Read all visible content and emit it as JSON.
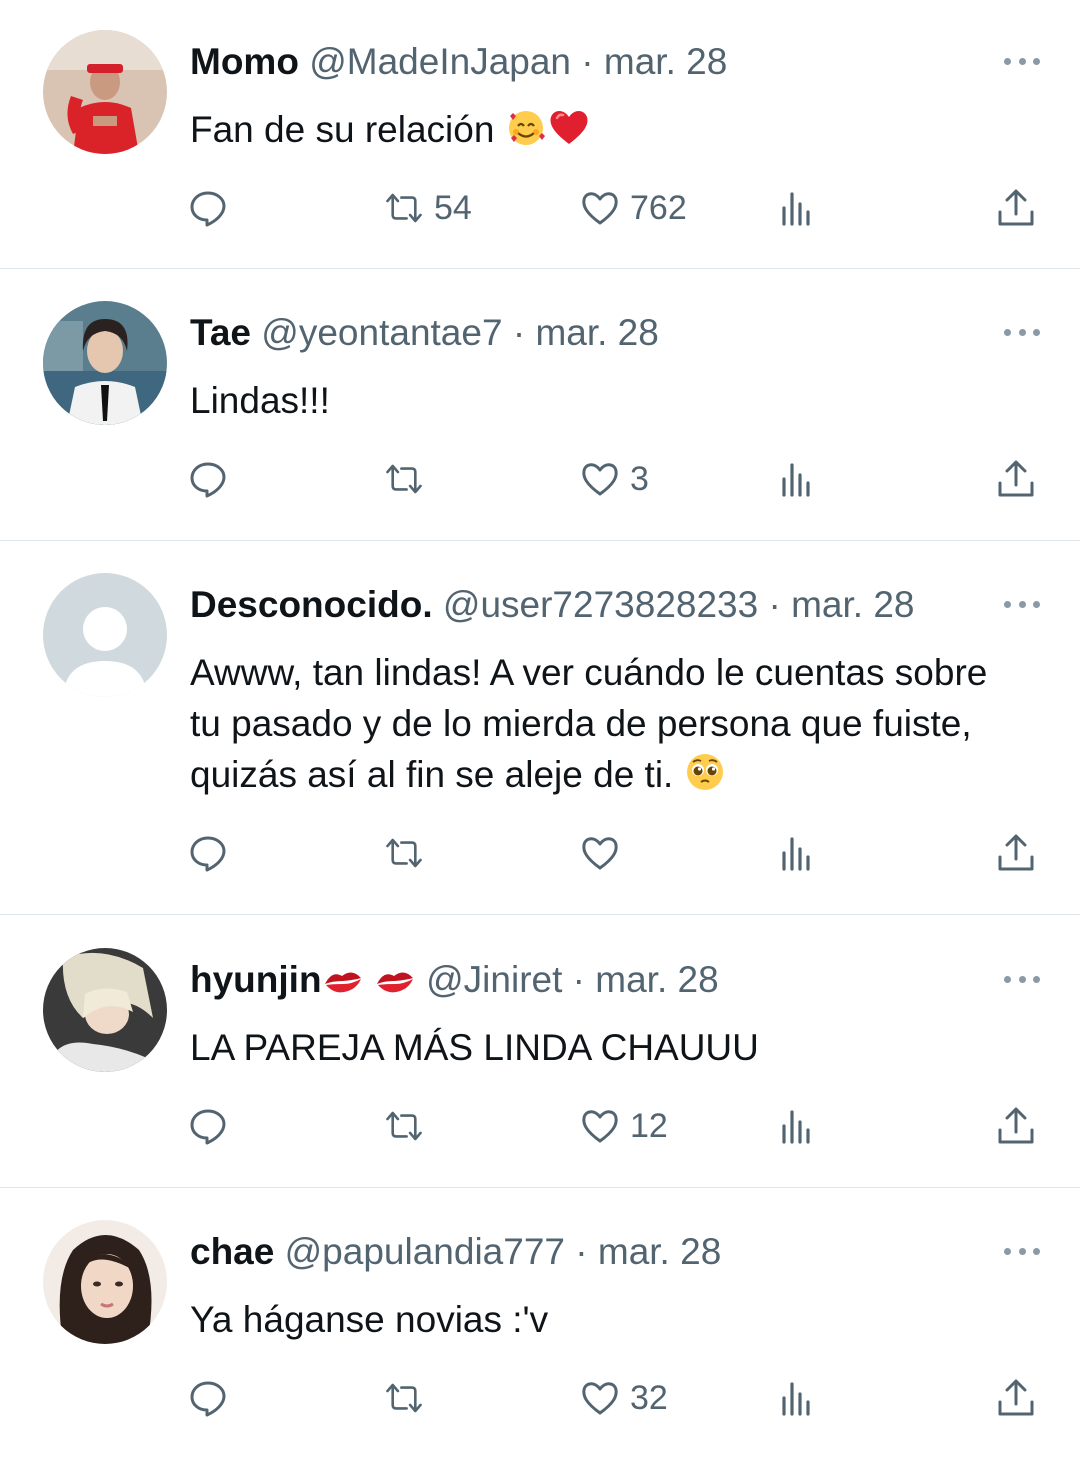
{
  "colors": {
    "text": "#0f1419",
    "muted": "#536471",
    "divider": "#dfe4e8",
    "icon": "#536471"
  },
  "tweets": [
    {
      "name": "Momo",
      "name_emoji": "",
      "handle": "@MadeInJapan",
      "separator": "·",
      "date": "mar. 28",
      "lines": [
        "Fan de su relación"
      ],
      "text_emoji": "smiling-face-with-hearts red-heart",
      "counts": {
        "replies": "",
        "retweets": "54",
        "likes": "762"
      }
    },
    {
      "name": "Tae",
      "name_emoji": "",
      "handle": "@yeontantae7",
      "separator": "·",
      "date": "mar. 28",
      "lines": [
        "Lindas!!!"
      ],
      "text_emoji": "",
      "counts": {
        "replies": "",
        "retweets": "",
        "likes": "3"
      }
    },
    {
      "name": "Desconocido.",
      "name_emoji": "",
      "handle": "@user7273828233",
      "separator": "·",
      "date": "mar. 28",
      "lines": [
        "Awww, tan lindas! A ver cuándo le cuentas sobre",
        "tu pasado y de lo mierda de persona que fuiste,",
        "quizás así al fin se aleje de ti."
      ],
      "text_emoji": "pleading-face",
      "counts": {
        "replies": "",
        "retweets": "",
        "likes": ""
      }
    },
    {
      "name": "hyunjin",
      "name_emoji": "kiss-mark kiss-mark",
      "handle": "@Jiniret",
      "separator": "·",
      "date": "mar. 28",
      "lines": [
        "LA PAREJA MÁS LINDA CHAUUU"
      ],
      "text_emoji": "",
      "counts": {
        "replies": "",
        "retweets": "",
        "likes": "12"
      }
    },
    {
      "name": "chae",
      "name_emoji": "",
      "handle": "@papulandia777",
      "separator": "·",
      "date": "mar. 28",
      "lines": [
        "Ya háganse novias :'v"
      ],
      "text_emoji": "",
      "counts": {
        "replies": "",
        "retweets": "",
        "likes": "32"
      }
    }
  ],
  "icons": [
    "reply-icon",
    "retweet-icon",
    "like-icon",
    "views-icon",
    "share-icon",
    "more-icon"
  ]
}
